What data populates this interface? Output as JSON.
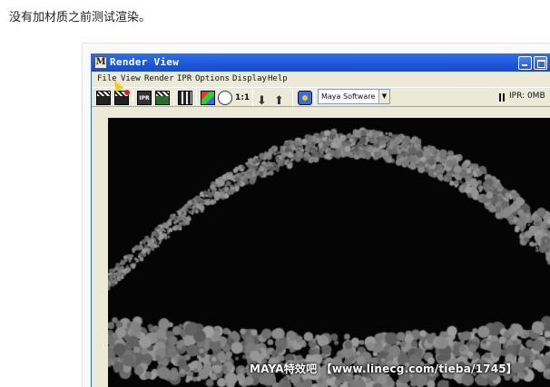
{
  "page": {
    "caption": "没有加材质之前测试渲染。"
  },
  "window": {
    "title": "Render View",
    "menu": [
      "File",
      "View",
      "Render",
      "IPR",
      "Options",
      "Display",
      "Help"
    ],
    "toolbar": {
      "icons": [
        "render-frame-icon",
        "render-region-icon",
        "ipr-render-icon",
        "ipr-refresh-icon",
        "snapshot-icon",
        "rgb-channels-icon",
        "alpha-channel-icon",
        "real-size-icon",
        "keep-image-icon",
        "remove-image-icon",
        "render-settings-icon"
      ],
      "real_size_label": "1:1",
      "ipr_label": "IPR",
      "renderer": "Maya Software",
      "ipr_status": "IPR: 0MB"
    }
  },
  "watermark": "MAYA特效吧 【www.linecg.com/tieba/1745】",
  "colors": {
    "titlebar": "#1c55d6",
    "viewport": "#050505",
    "particles": "#8a8a8a",
    "window_bg": "#ece9d8"
  }
}
